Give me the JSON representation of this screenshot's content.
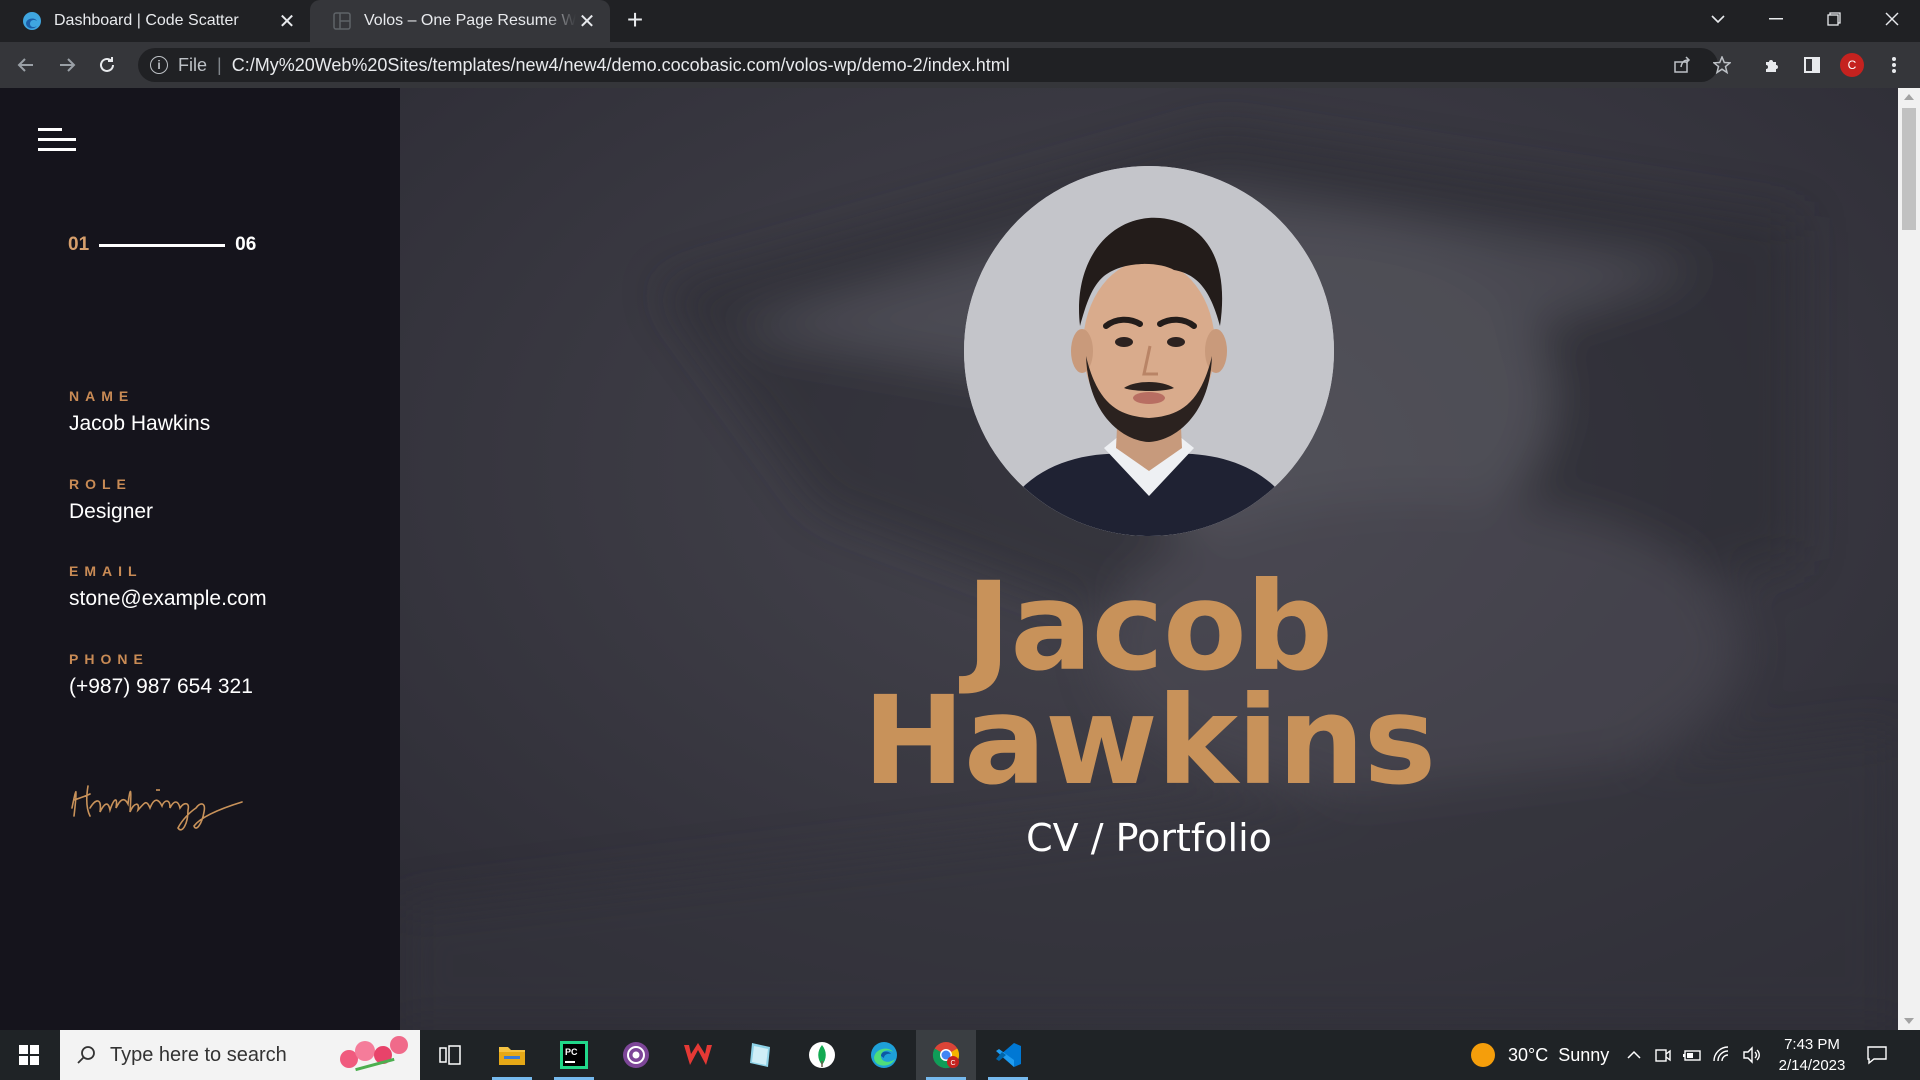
{
  "browser": {
    "tabs": [
      {
        "title": "Dashboard | Code Scatter",
        "active": false
      },
      {
        "title": "Volos – One Page Resume WordPress Theme",
        "active": true
      }
    ],
    "address": {
      "scheme_label": "File",
      "url": "C:/My%20Web%20Sites/templates/new4/new4/demo.cocobasic.com/volos-wp/demo-2/index.html"
    },
    "profile_initial": "C"
  },
  "sidebar": {
    "counter": {
      "current": "01",
      "total": "06"
    },
    "info": [
      {
        "label": "NAME",
        "value": "Jacob Hawkins"
      },
      {
        "label": "ROLE",
        "value": "Designer"
      },
      {
        "label": "EMAIL",
        "value": "stone@example.com"
      },
      {
        "label": "PHONE",
        "value": "(+987) 987 654 321"
      }
    ],
    "signature_text": "Hawkings"
  },
  "hero": {
    "first_name": "Jacob",
    "last_name": "Hawkins",
    "subtitle": "CV / Portfolio"
  },
  "taskbar": {
    "search_placeholder": "Type here to search",
    "weather": {
      "temp": "30°C",
      "condition": "Sunny"
    },
    "time": "7:43 PM",
    "date": "2/14/2023"
  },
  "colors": {
    "accent": "#c8925a",
    "sidebar_bg": "#15141c",
    "hero_bg": "#3d3c47"
  }
}
